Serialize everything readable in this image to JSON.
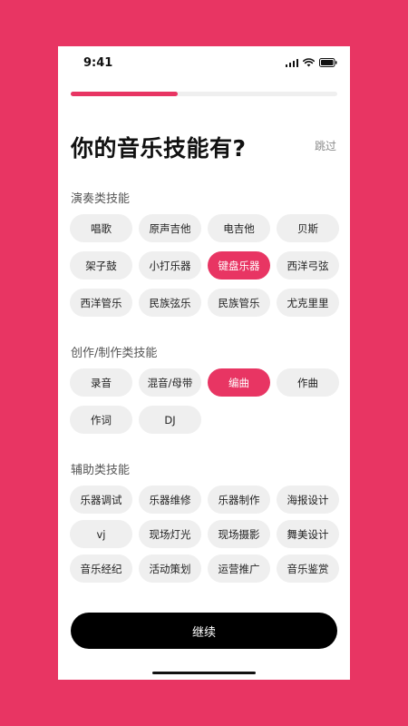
{
  "status_bar": {
    "time": "9:41"
  },
  "progress": {
    "fraction": 0.4
  },
  "header": {
    "title": "你的音乐技能有?",
    "skip_label": "跳过"
  },
  "sections": [
    {
      "label": "演奏类技能",
      "chips": [
        "唱歌",
        "原声吉他",
        "电吉他",
        "贝斯",
        "架子鼓",
        "小打乐器",
        "键盘乐器",
        "西洋弓弦",
        "西洋管乐",
        "民族弦乐",
        "民族管乐",
        "尤克里里"
      ],
      "selected": [
        "键盘乐器"
      ]
    },
    {
      "label": "创作/制作类技能",
      "chips": [
        "录音",
        "混音/母带",
        "编曲",
        "作曲",
        "作词",
        "DJ"
      ],
      "selected": [
        "编曲"
      ]
    },
    {
      "label": "辅助类技能",
      "chips": [
        "乐器调试",
        "乐器维修",
        "乐器制作",
        "海报设计",
        "vj",
        "现场灯光",
        "现场摄影",
        "舞美设计",
        "音乐经纪",
        "活动策划",
        "运营推广",
        "音乐鉴赏"
      ],
      "selected": []
    }
  ],
  "footer": {
    "continue_label": "继续"
  },
  "colors": {
    "accent": "#E83563",
    "chip_bg": "#EFEFEF",
    "button_bg": "#000000"
  }
}
